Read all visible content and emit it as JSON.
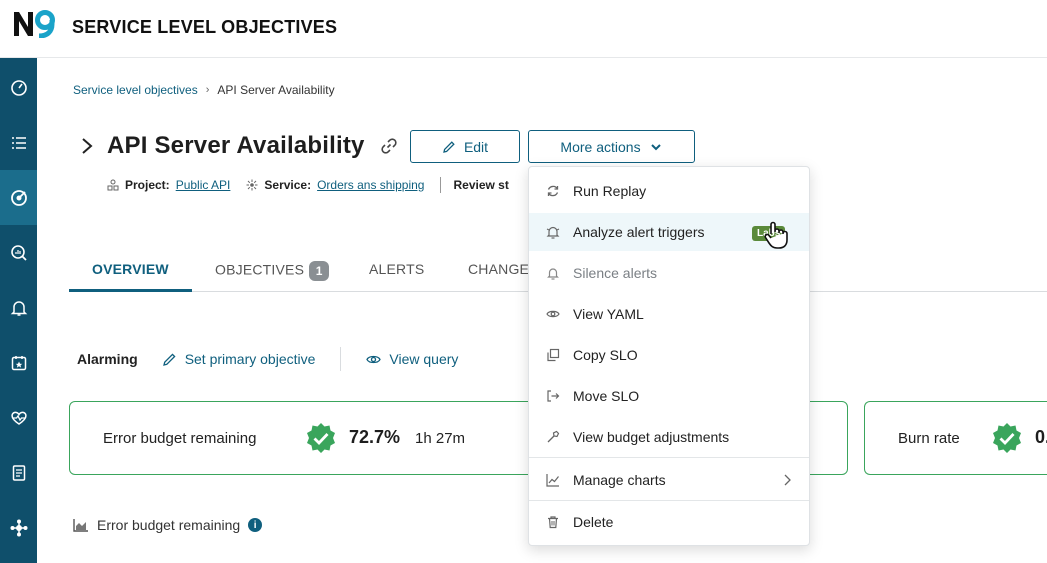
{
  "app": {
    "logo_text": "N9",
    "title": "SERVICE LEVEL OBJECTIVES"
  },
  "breadcrumb": {
    "parent": "Service level objectives",
    "separator": "›",
    "current": "API Server Availability"
  },
  "header": {
    "title": "API Server Availability",
    "edit_label": "Edit",
    "more_actions_label": "More actions"
  },
  "meta": {
    "project_label": "Project:",
    "project_value": "Public API",
    "service_label": "Service:",
    "service_value": "Orders ans shipping",
    "review_label": "Review st"
  },
  "tabs": [
    {
      "label": "OVERVIEW"
    },
    {
      "label": "OBJECTIVES",
      "badge": "1"
    },
    {
      "label": "ALERTS"
    },
    {
      "label": "CHANGE"
    }
  ],
  "toolbar": {
    "alarming_label": "Alarming",
    "set_primary_label": "Set primary objective",
    "view_query_label": "View query"
  },
  "cards": {
    "error_budget": {
      "label": "Error budget remaining",
      "value": "72.7%",
      "time": "1h 27m"
    },
    "burn_rate": {
      "label": "Burn rate",
      "value": "0."
    }
  },
  "section": {
    "label": "Error budget remaining",
    "info": "i"
  },
  "dropdown": {
    "items": [
      {
        "label": "Run Replay",
        "icon": "refresh-icon"
      },
      {
        "label": "Analyze alert triggers",
        "icon": "alert-analyze-icon",
        "badge": "Labs"
      },
      {
        "label": "Silence alerts",
        "icon": "bell-icon",
        "disabled": true
      },
      {
        "label": "View YAML",
        "icon": "eye-icon"
      },
      {
        "label": "Copy SLO",
        "icon": "copy-icon"
      },
      {
        "label": "Move SLO",
        "icon": "move-icon"
      },
      {
        "label": "View budget adjustments",
        "icon": "adjust-icon"
      },
      {
        "label": "Manage charts",
        "icon": "chart-icon"
      },
      {
        "label": "Delete",
        "icon": "trash-icon"
      }
    ]
  },
  "colors": {
    "brand": "#0f5f7e",
    "sidebar": "#0f4f6b",
    "success": "#3aa55c",
    "labs": "#5a8a3a"
  }
}
